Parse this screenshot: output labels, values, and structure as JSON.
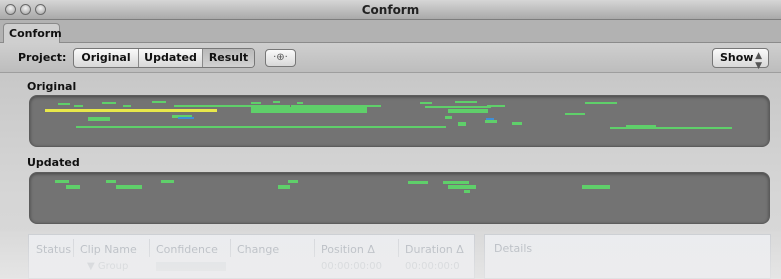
{
  "window": {
    "title": "Conform"
  },
  "tab": {
    "label": "Conform"
  },
  "toolbar": {
    "project_label": "Project:",
    "segments": [
      "Original",
      "Updated",
      "Result"
    ],
    "selected_segment": "Result",
    "zoom_icon": "zoom-icon",
    "show_label": "Show"
  },
  "sections": {
    "original_label": "Original",
    "updated_label": "Updated"
  },
  "table": {
    "headers": [
      "Status",
      "Clip Name",
      "Confidence",
      "Change",
      "Position Δ",
      "Duration Δ"
    ],
    "rows": [
      {
        "clip_name": "▼ Group",
        "position": "00:00:00:00",
        "duration": "00:00:00:0"
      }
    ]
  },
  "details": {
    "label": "Details"
  },
  "colors": {
    "clip_green": "#5fcf6a",
    "clip_yellow": "#e8e84a",
    "clip_blue": "#3f8fd6",
    "track_bg": "#737373"
  }
}
